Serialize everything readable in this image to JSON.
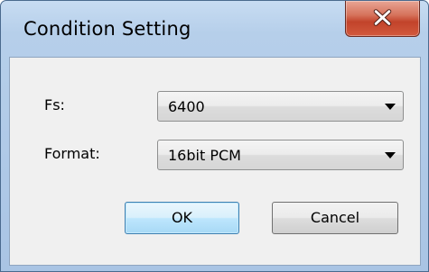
{
  "window": {
    "title": "Condition Setting"
  },
  "icons": {
    "close": "close-icon"
  },
  "form": {
    "fs_label": "Fs:",
    "fs_value": "6400",
    "format_label": "Format:",
    "format_value": "16bit PCM"
  },
  "buttons": {
    "ok_label": "OK",
    "cancel_label": "Cancel"
  },
  "colors": {
    "title_bar": "#b6cfea",
    "close_button": "#c2432a",
    "default_button": "#bee6fd"
  }
}
